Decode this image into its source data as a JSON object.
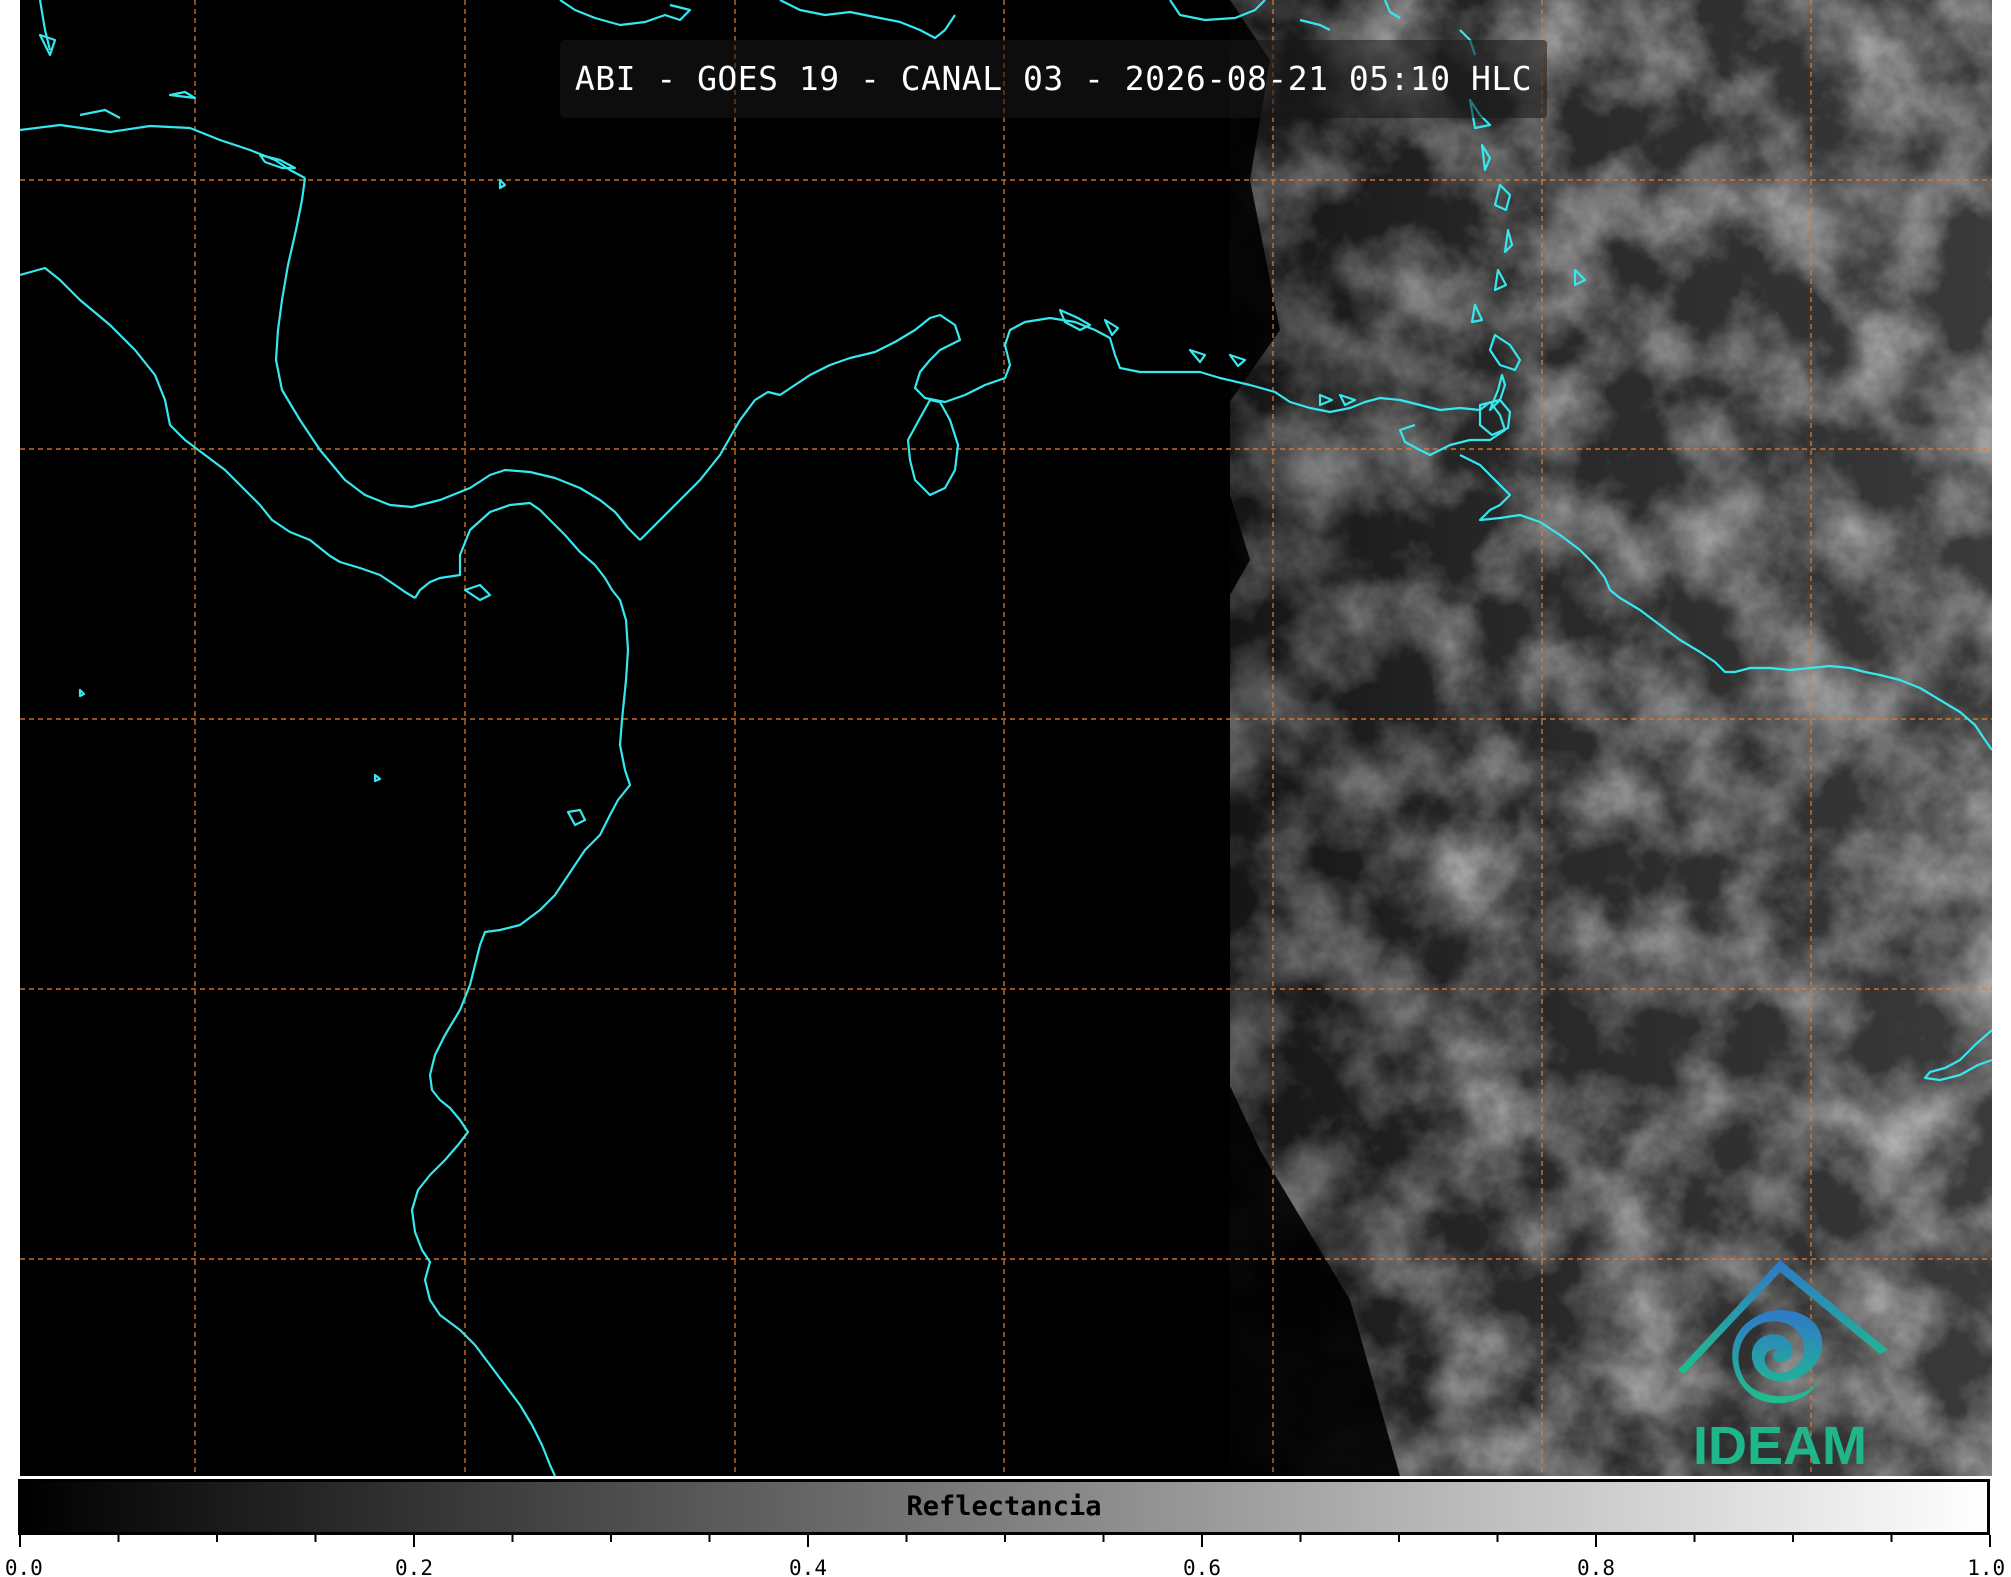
{
  "title": "ABI - GOES 19 - CANAL 03 - 2026-08-21 05:10 HLC",
  "logo": {
    "text": "IDEAM",
    "name": "ideam-logo"
  },
  "colorbar": {
    "label": "Reflectancia",
    "min": 0.0,
    "max": 1.0,
    "colormap": [
      "#000000",
      "#ffffff"
    ],
    "major_ticks": [
      "0.0",
      "0.2",
      "0.4",
      "0.6",
      "0.8",
      "1.0"
    ],
    "minor_tick_step": 0.05
  },
  "map": {
    "background": "#000000",
    "coastline_color": "#35e8ef",
    "gridline_color": "#e07a2c",
    "gridline_style": "dashed",
    "imagery": "grayscale visible reflectance, night on west half"
  }
}
